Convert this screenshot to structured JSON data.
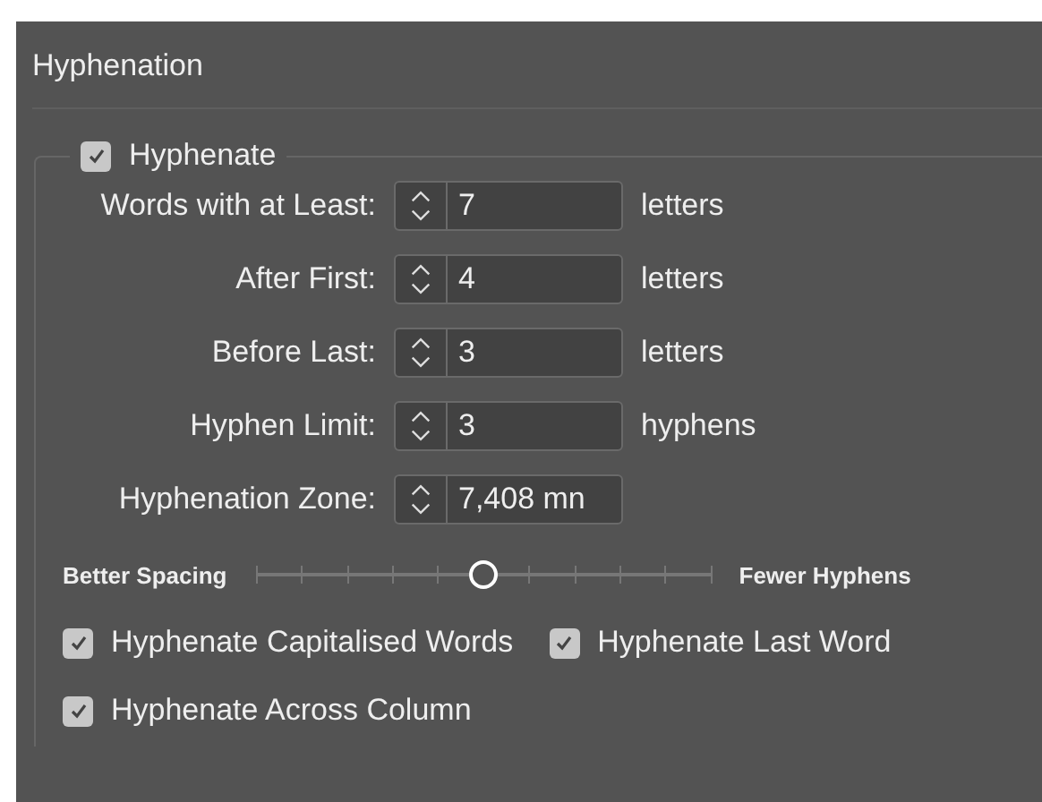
{
  "panel": {
    "title": "Hyphenation"
  },
  "hyphenate": {
    "label": "Hyphenate",
    "checked": true
  },
  "fields": [
    {
      "label": "Words with at Least:",
      "value": "7",
      "unit": "letters"
    },
    {
      "label": "After First:",
      "value": "4",
      "unit": "letters"
    },
    {
      "label": "Before Last:",
      "value": "3",
      "unit": "letters"
    },
    {
      "label": "Hyphen Limit:",
      "value": "3",
      "unit": "hyphens"
    },
    {
      "label": "Hyphenation Zone:",
      "value": "7,408 mn"
    }
  ],
  "slider": {
    "left_label": "Better Spacing",
    "right_label": "Fewer Hyphens",
    "level": 0.5
  },
  "options": [
    {
      "label": "Hyphenate Capitalised Words",
      "checked": true
    },
    {
      "label": "Hyphenate Last Word",
      "checked": true
    },
    {
      "label": "Hyphenate Across Column",
      "checked": true
    }
  ]
}
